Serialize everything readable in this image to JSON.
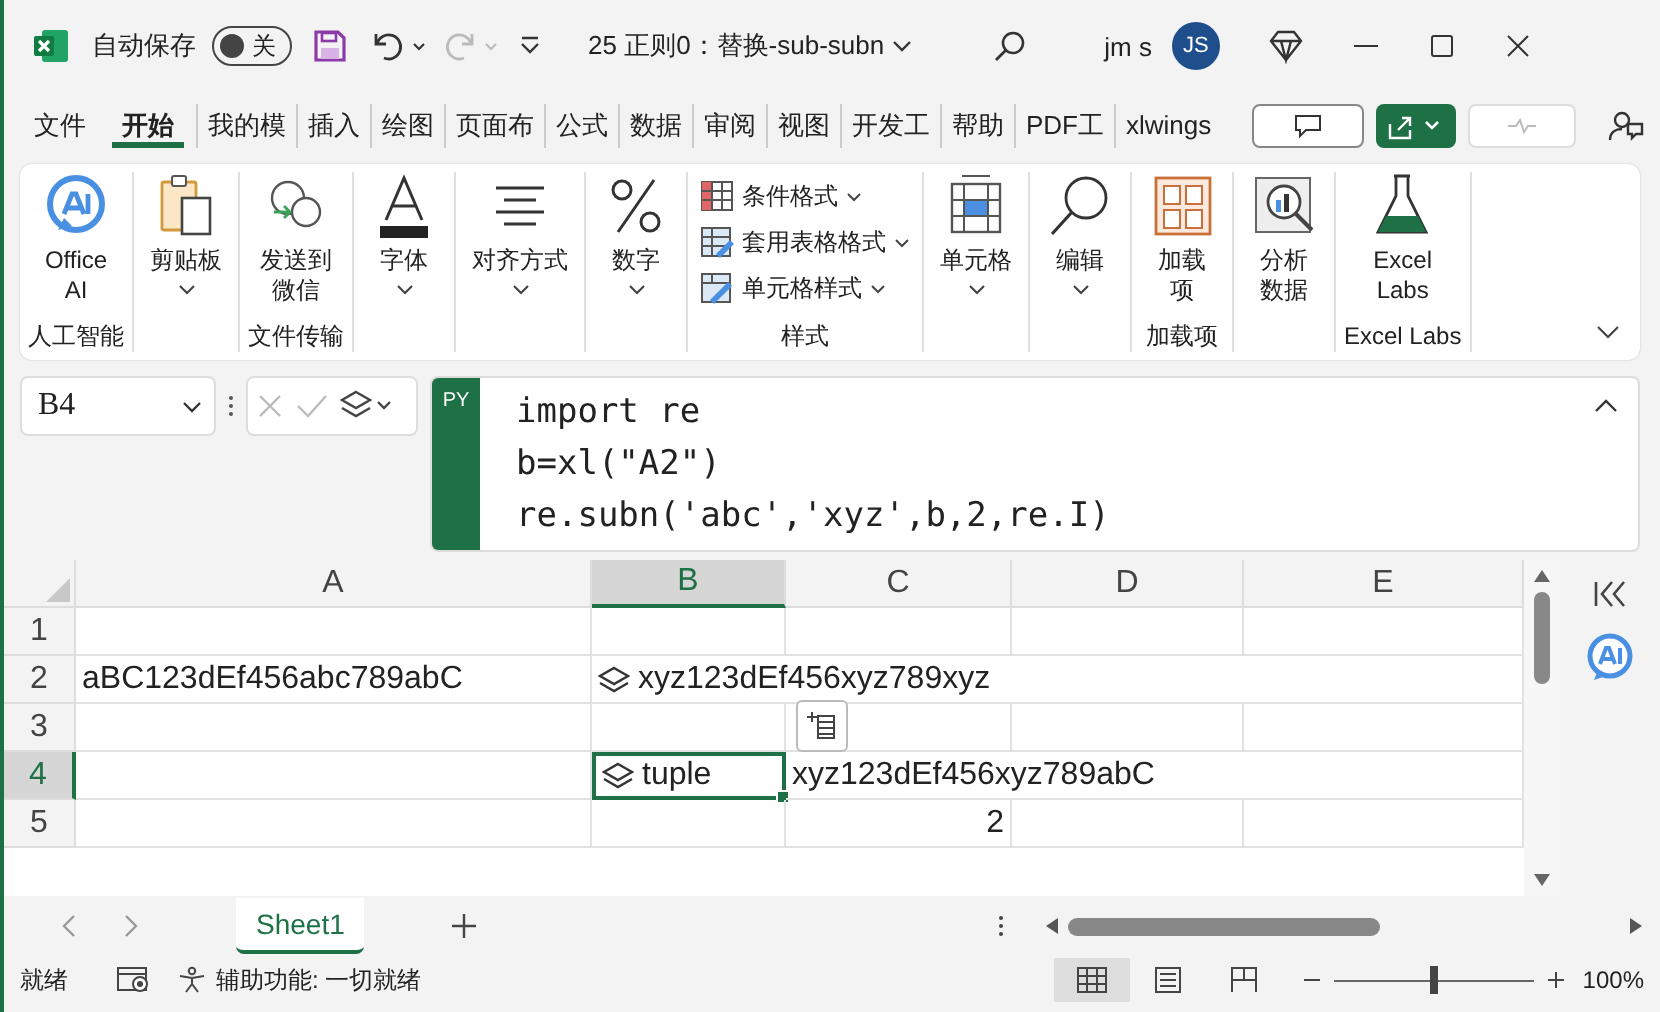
{
  "titlebar": {
    "autosave_label": "自动保存",
    "autosave": {
      "label": "关",
      "on": false
    },
    "title": "25 正则0：替换-sub-subn",
    "user": "jm s",
    "avatar": "JS"
  },
  "menu_tabs": [
    {
      "label": "文件",
      "selected": false
    },
    {
      "label": "开始",
      "selected": true
    },
    {
      "label": "我的模",
      "selected": false
    },
    {
      "label": "插入",
      "selected": false
    },
    {
      "label": "绘图",
      "selected": false
    },
    {
      "label": "页面布",
      "selected": false
    },
    {
      "label": "公式",
      "selected": false
    },
    {
      "label": "数据",
      "selected": false
    },
    {
      "label": "审阅",
      "selected": false
    },
    {
      "label": "视图",
      "selected": false
    },
    {
      "label": "开发工",
      "selected": false
    },
    {
      "label": "帮助",
      "selected": false
    },
    {
      "label": "PDF工",
      "selected": false
    },
    {
      "label": "xlwings",
      "selected": false
    }
  ],
  "ribbon": {
    "groups": [
      {
        "label": "人工智能",
        "items": [
          {
            "kind": "large",
            "label": "Office AI",
            "dropdown": false
          }
        ]
      },
      {
        "items": [
          {
            "kind": "large",
            "label": "剪贴板",
            "dropdown": true
          }
        ]
      },
      {
        "label": "文件传输",
        "items": [
          {
            "kind": "large",
            "label": "发送到微信",
            "dropdown": false
          }
        ]
      },
      {
        "items": [
          {
            "kind": "large",
            "label": "字体",
            "dropdown": true
          }
        ]
      },
      {
        "items": [
          {
            "kind": "large",
            "label": "对齐方式",
            "dropdown": true
          }
        ]
      },
      {
        "items": [
          {
            "kind": "large",
            "label": "数字",
            "dropdown": true
          }
        ]
      },
      {
        "label": "样式",
        "items": [
          {
            "kind": "small",
            "label": "条件格式",
            "dropdown": true
          },
          {
            "kind": "small",
            "label": "套用表格格式",
            "dropdown": true
          },
          {
            "kind": "small",
            "label": "单元格样式",
            "dropdown": true
          }
        ]
      },
      {
        "items": [
          {
            "kind": "large",
            "label": "单元格",
            "dropdown": true
          }
        ]
      },
      {
        "items": [
          {
            "kind": "large",
            "label": "编辑",
            "dropdown": true
          }
        ]
      },
      {
        "label": "加载项",
        "items": [
          {
            "kind": "large",
            "label": "加载项",
            "dropdown": false
          }
        ]
      },
      {
        "items": [
          {
            "kind": "large",
            "label": "分析数据",
            "dropdown": false
          }
        ]
      },
      {
        "label": "Excel Labs",
        "items": [
          {
            "kind": "large",
            "label": "Excel Labs",
            "dropdown": false
          }
        ]
      }
    ]
  },
  "formula_bar": {
    "name_box": "B4",
    "badge": "PY",
    "code": [
      "import re",
      "b=xl(\"A2\")",
      "re.subn('abc','xyz',b,2,re.I)"
    ]
  },
  "sheet": {
    "columns": [
      {
        "label": "A",
        "selected": false
      },
      {
        "label": "B",
        "selected": true
      },
      {
        "label": "C",
        "selected": false
      },
      {
        "label": "D",
        "selected": false
      },
      {
        "label": "E",
        "selected": false
      }
    ],
    "rows": [
      {
        "label": "1",
        "selected": false,
        "cells": [
          {},
          {},
          {},
          {},
          {}
        ]
      },
      {
        "label": "2",
        "selected": false,
        "cells": [
          {
            "kind": "text",
            "text": "aBC123dEf456abc789abC"
          },
          {
            "kind": "python",
            "text": "xyz123dEf456xyz789xyz",
            "selected": false
          },
          {},
          {},
          {}
        ]
      },
      {
        "label": "3",
        "selected": false,
        "cells": [
          {},
          {},
          {},
          {},
          {}
        ]
      },
      {
        "label": "4",
        "selected": true,
        "cells": [
          {},
          {
            "kind": "python",
            "text": "tuple",
            "selected": true
          },
          {
            "kind": "text",
            "text": "xyz123dEf456xyz789abC"
          },
          {},
          {}
        ]
      },
      {
        "label": "5",
        "selected": false,
        "cells": [
          {},
          {},
          {
            "kind": "number",
            "text": "2"
          },
          {},
          {}
        ]
      }
    ]
  },
  "sheet_tabs": [
    {
      "label": "Sheet1",
      "selected": true
    }
  ],
  "status_bar": {
    "ready": "就绪",
    "accessibility": "辅助功能: 一切就绪",
    "views": [
      {
        "selected": true
      },
      {
        "selected": false
      },
      {
        "selected": false
      }
    ],
    "zoom": {
      "level": 0.5,
      "reading": "100%"
    }
  }
}
